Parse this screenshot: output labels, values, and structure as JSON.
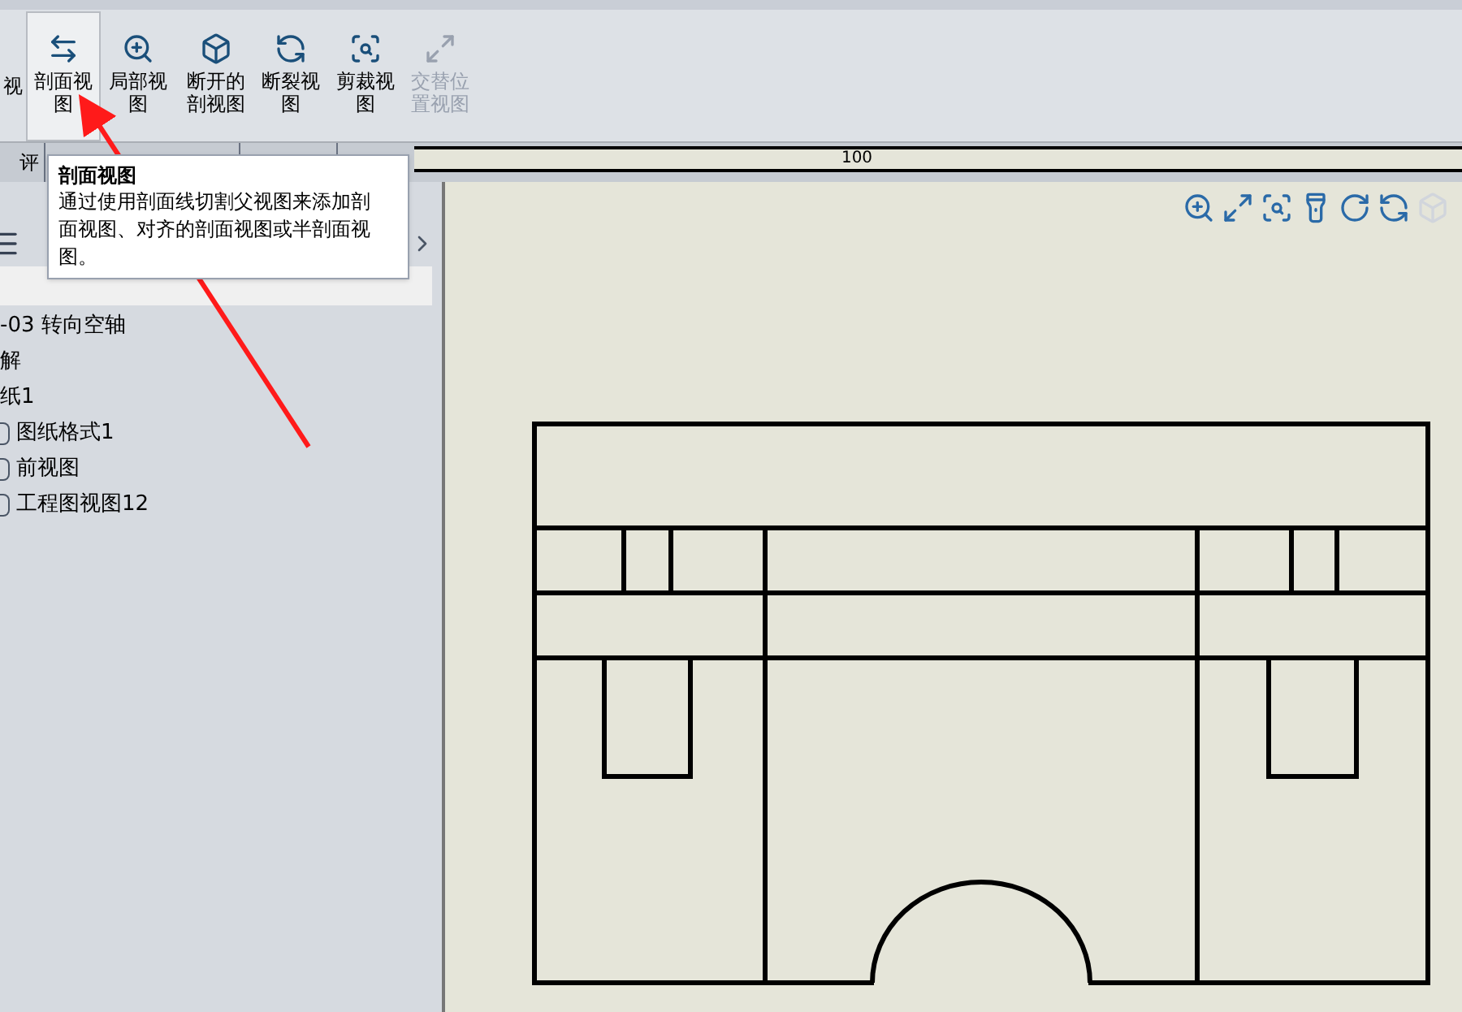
{
  "toolbar": {
    "buttons": [
      {
        "label": "视",
        "selected": false,
        "disabled": false,
        "cut": true
      },
      {
        "label": "剖面视图",
        "selected": true,
        "disabled": false
      },
      {
        "label": "局部视图",
        "selected": false,
        "disabled": false
      },
      {
        "label": "断开的剖视图",
        "selected": false,
        "disabled": false
      },
      {
        "label": "断裂视图",
        "selected": false,
        "disabled": false
      },
      {
        "label": "剪裁视图",
        "selected": false,
        "disabled": false
      },
      {
        "label": "交替位置视图",
        "selected": false,
        "disabled": true
      }
    ]
  },
  "tabs": [
    {
      "label": "评"
    }
  ],
  "tooltip": {
    "title": "剖面视图",
    "body": "通过使用剖面线切割父视图来添加剖面视图、对齐的剖面视图或半剖面视图。"
  },
  "ruler": {
    "label": "100"
  },
  "tree": [
    {
      "label": "-03 转向空轴"
    },
    {
      "label": "解"
    },
    {
      "label": "纸1",
      "children": [
        {
          "label": "图纸格式1"
        },
        {
          "label": "前视图"
        },
        {
          "label": "工程图视图12"
        }
      ]
    }
  ]
}
